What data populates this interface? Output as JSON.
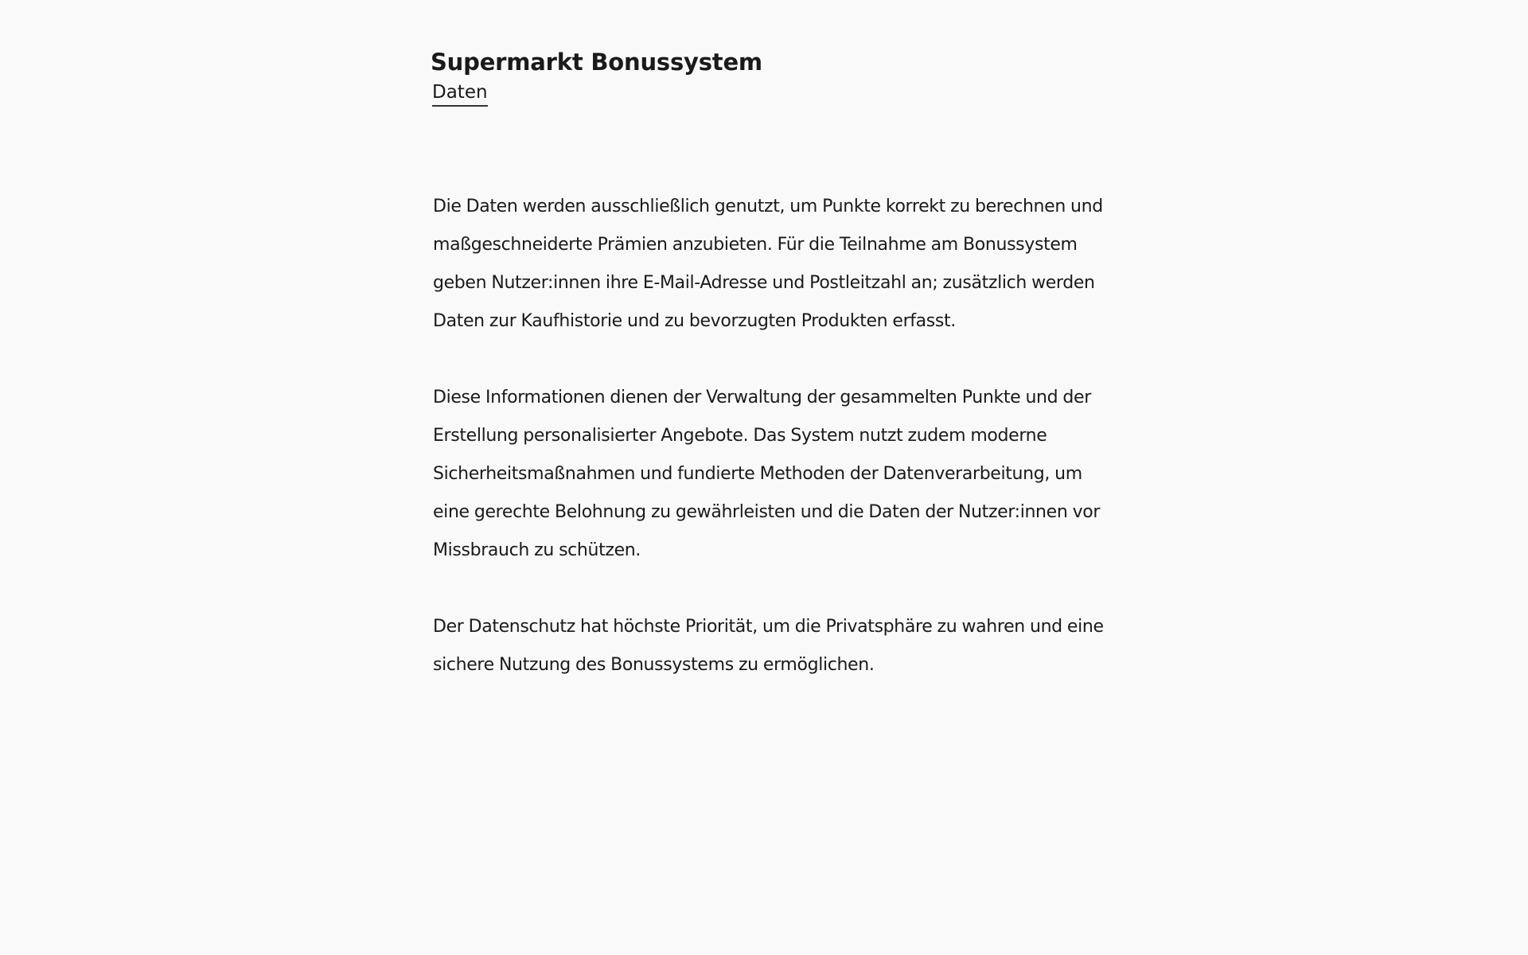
{
  "header": {
    "title": "Supermarkt Bonussystem",
    "nav": {
      "daten_label": "Daten"
    }
  },
  "main": {
    "paragraphs": [
      "Die Daten werden ausschließlich genutzt, um Punkte korrekt zu berechnen und maßgeschneiderte Prämien anzubieten. Für die Teilnahme am Bonussystem geben Nutzer:innen ihre E-Mail-Adresse und Postleitzahl an; zusätzlich werden Daten zur Kaufhistorie und zu bevorzugten Produkten erfasst.",
      "Diese Informationen dienen der Verwaltung der gesammelten Punkte und der Erstellung personalisierter Angebote. Das System nutzt zudem moderne Sicherheitsmaßnahmen und fundierte Methoden der Datenverarbeitung, um eine gerechte Belohnung zu gewährleisten und die Daten der Nutzer:innen vor Missbrauch zu schützen.",
      "Der Datenschutz hat höchste Priorität, um die Privatsphäre zu wahren und eine sichere Nutzung des Bonussystems zu ermöglichen."
    ]
  },
  "colors": {
    "background": "#f9f9f9",
    "text": "#1a1a1a"
  }
}
